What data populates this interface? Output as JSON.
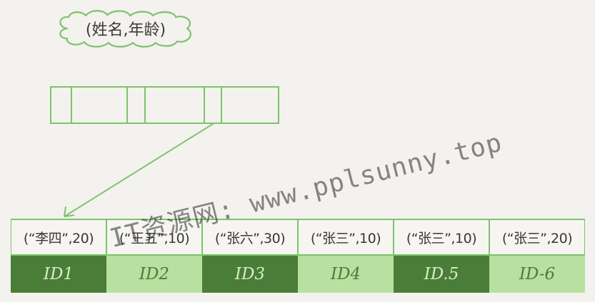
{
  "index_label": "(姓名,年龄)",
  "leaf_entries": [
    {
      "key": "(“李四”,20)",
      "id": "ID1",
      "shade": "dark"
    },
    {
      "key": "(“王五”,10)",
      "id": "ID2",
      "shade": "light"
    },
    {
      "key": "(“张六”,30)",
      "id": "ID3",
      "shade": "dark"
    },
    {
      "key": "(“张三”,10)",
      "id": "ID4",
      "shade": "light"
    },
    {
      "key": "(“张三”,10)",
      "id": "ID.5",
      "shade": "dark"
    },
    {
      "key": "(“张三”,20)",
      "id": "ID-6",
      "shade": "light"
    }
  ],
  "watermark": "IT资源网: www.pplsunny.top",
  "colors": {
    "outline": "#7bc46b",
    "dark_cell": "#4a7d38",
    "light_cell": "#b9e0a0",
    "background": "#f4f2ee"
  }
}
